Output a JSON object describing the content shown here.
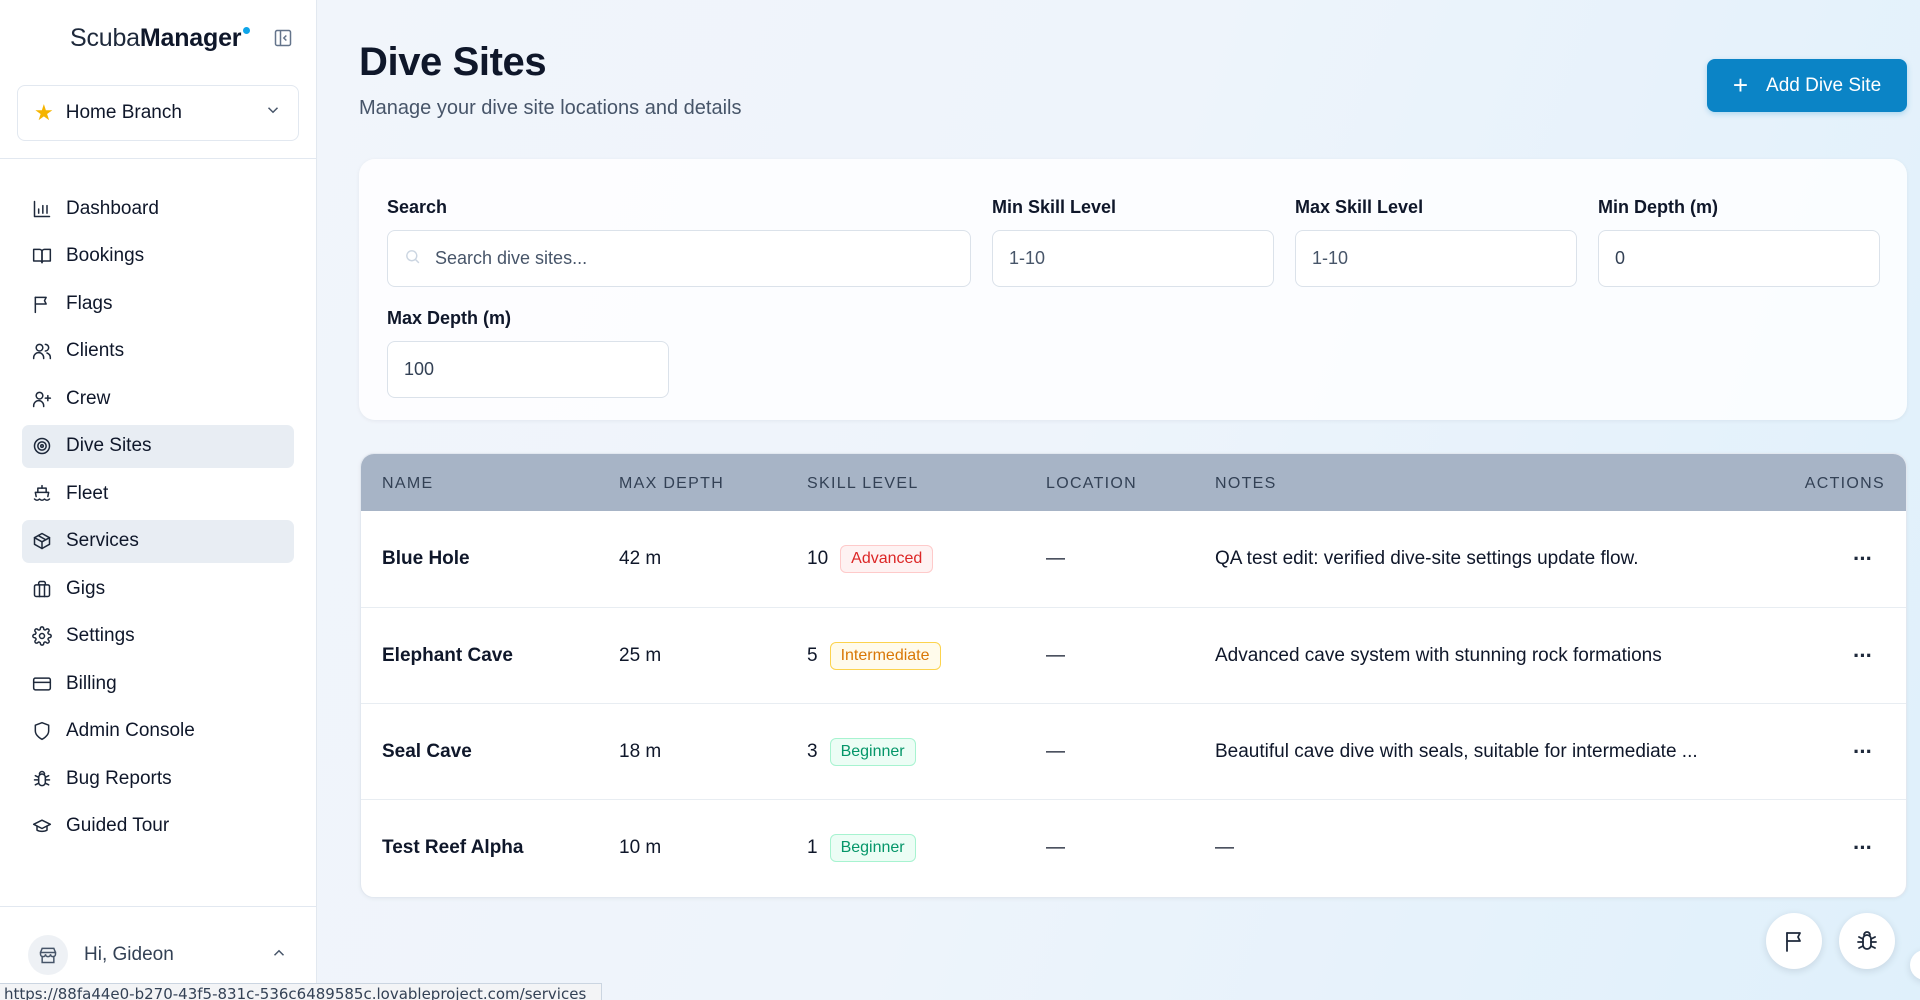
{
  "brand": {
    "prefix": "Scuba",
    "suffix": "Manager"
  },
  "branch": {
    "label": "Home Branch"
  },
  "nav": [
    {
      "label": "Dashboard",
      "icon": "bar-chart-icon",
      "active": false
    },
    {
      "label": "Bookings",
      "icon": "book-open-icon",
      "active": false
    },
    {
      "label": "Flags",
      "icon": "flag-icon",
      "active": false
    },
    {
      "label": "Clients",
      "icon": "users-icon",
      "active": false
    },
    {
      "label": "Crew",
      "icon": "user-plus-icon",
      "active": false
    },
    {
      "label": "Dive Sites",
      "icon": "target-icon",
      "active": true
    },
    {
      "label": "Fleet",
      "icon": "ship-icon",
      "active": false
    },
    {
      "label": "Services",
      "icon": "package-icon",
      "active": true
    },
    {
      "label": "Gigs",
      "icon": "briefcase-icon",
      "active": false
    },
    {
      "label": "Settings",
      "icon": "gear-icon",
      "active": false
    },
    {
      "label": "Billing",
      "icon": "credit-card-icon",
      "active": false
    },
    {
      "label": "Admin Console",
      "icon": "shield-icon",
      "active": false
    },
    {
      "label": "Bug Reports",
      "icon": "bug-icon",
      "active": false
    },
    {
      "label": "Guided Tour",
      "icon": "graduation-cap-icon",
      "active": false
    }
  ],
  "user": {
    "greeting": "Hi, Gideon"
  },
  "status_url": "https://88fa44e0-b270-43f5-831c-536c6489585c.lovableproject.com/services",
  "page": {
    "title": "Dive Sites",
    "subtitle": "Manage your dive site locations and details",
    "add_button": "Add Dive Site"
  },
  "filters": {
    "search": {
      "label": "Search",
      "placeholder": "Search dive sites..."
    },
    "min_skill": {
      "label": "Min Skill Level",
      "placeholder": "1-10"
    },
    "max_skill": {
      "label": "Max Skill Level",
      "placeholder": "1-10"
    },
    "min_depth": {
      "label": "Min Depth (m)",
      "value": "0"
    },
    "max_depth": {
      "label": "Max Depth (m)",
      "value": "100"
    }
  },
  "table": {
    "columns": [
      "Name",
      "Max Depth",
      "Skill Level",
      "Location",
      "Notes",
      "Actions"
    ],
    "rows": [
      {
        "name": "Blue Hole",
        "depth": "42 m",
        "skill": "10",
        "badge": "Advanced",
        "badge_type": "adv",
        "location": "—",
        "notes": "QA test edit: verified dive-site settings update flow."
      },
      {
        "name": "Elephant Cave",
        "depth": "25 m",
        "skill": "5",
        "badge": "Intermediate",
        "badge_type": "int",
        "location": "—",
        "notes": "Advanced cave system with stunning rock formations"
      },
      {
        "name": "Seal Cave",
        "depth": "18 m",
        "skill": "3",
        "badge": "Beginner",
        "badge_type": "beg",
        "location": "—",
        "notes": "Beautiful cave dive with seals, suitable for intermediate ..."
      },
      {
        "name": "Test Reef Alpha",
        "depth": "10 m",
        "skill": "1",
        "badge": "Beginner",
        "badge_type": "beg",
        "location": "—",
        "notes": "—"
      }
    ]
  },
  "colors": {
    "accent": "#0b84c6",
    "header_bg": "#a7b4c6",
    "active_nav": "#e8edf3"
  }
}
